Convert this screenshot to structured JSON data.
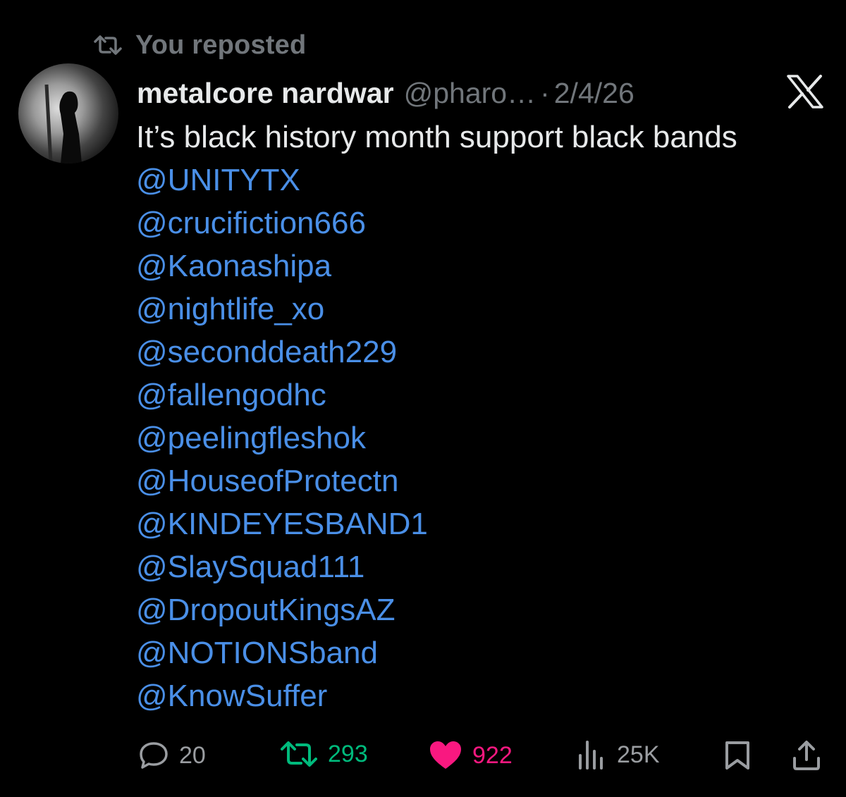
{
  "repost_banner": {
    "icon": "repost-icon",
    "label": "You reposted"
  },
  "tweet": {
    "author_name": "metalcore nardwar",
    "author_handle": "@pharo…",
    "separator": "·",
    "date": "2/4/26",
    "text_line": "It’s black history month support black bands",
    "mentions": [
      "@UNITYTX",
      "@crucifiction666",
      "@Kaonashipa",
      "@nightlife_xo",
      "@seconddeath229",
      "@fallengodhc",
      "@peelingfleshok",
      "@HouseofProtectn",
      "@KINDEYESBAND1",
      "@SlaySquad111",
      "@DropoutKingsAZ",
      "@NOTIONSband",
      "@KnowSuffer"
    ]
  },
  "actions": {
    "replies": "20",
    "reposts": "293",
    "likes": "922",
    "views": "25K"
  },
  "colors": {
    "background": "#000000",
    "mention": "#4a8fe7",
    "muted": "#71767b",
    "repost_active": "#00ba7c",
    "like_active": "#f91880"
  }
}
